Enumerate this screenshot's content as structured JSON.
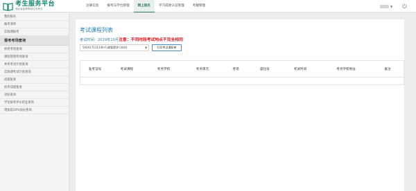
{
  "header": {
    "logo_title": "考生服务平台",
    "logo_subtitle": "湖北省高等教育自学考试",
    "nav": [
      "注册信息",
      "报考与学位管理",
      "网上报名",
      "学习成绩认证管理",
      "考籍管理"
    ],
    "active_nav_index": 2
  },
  "sidebar": {
    "items_before": [
      "我的报名",
      "报考清单",
      "实践课报考"
    ],
    "section": "报考考场查询",
    "items_after": [
      "机考考场查询",
      "课程管理考场查询",
      "共考考试计划查询",
      "实践课考试计划查询",
      "成绩复查",
      "机考成绩复查",
      "违纪查询",
      "学位报考评价结业查询",
      "增加前30%加分查询"
    ]
  },
  "main": {
    "title": "考试课程列表",
    "exam_time_label": "考试时间：2019年10月",
    "notice": "注意：不同时段考试地点不完全相同",
    "select_value": "500417111140-行政管理学-(本科)",
    "print_button": "打印考试通知单"
  },
  "table": {
    "columns": [
      "准考证号",
      "考试课程",
      "考点学校",
      "考点单元",
      "考场",
      "座位号",
      "考试时间",
      "考点学校地址",
      "备注"
    ],
    "rows": []
  },
  "colors": {
    "brand": "#17866f",
    "accent_blue": "#2a7db0",
    "notice_red": "#d9161d"
  },
  "icons": [
    "book-logo-icon",
    "chevron-down-icon",
    "logout-icon"
  ]
}
